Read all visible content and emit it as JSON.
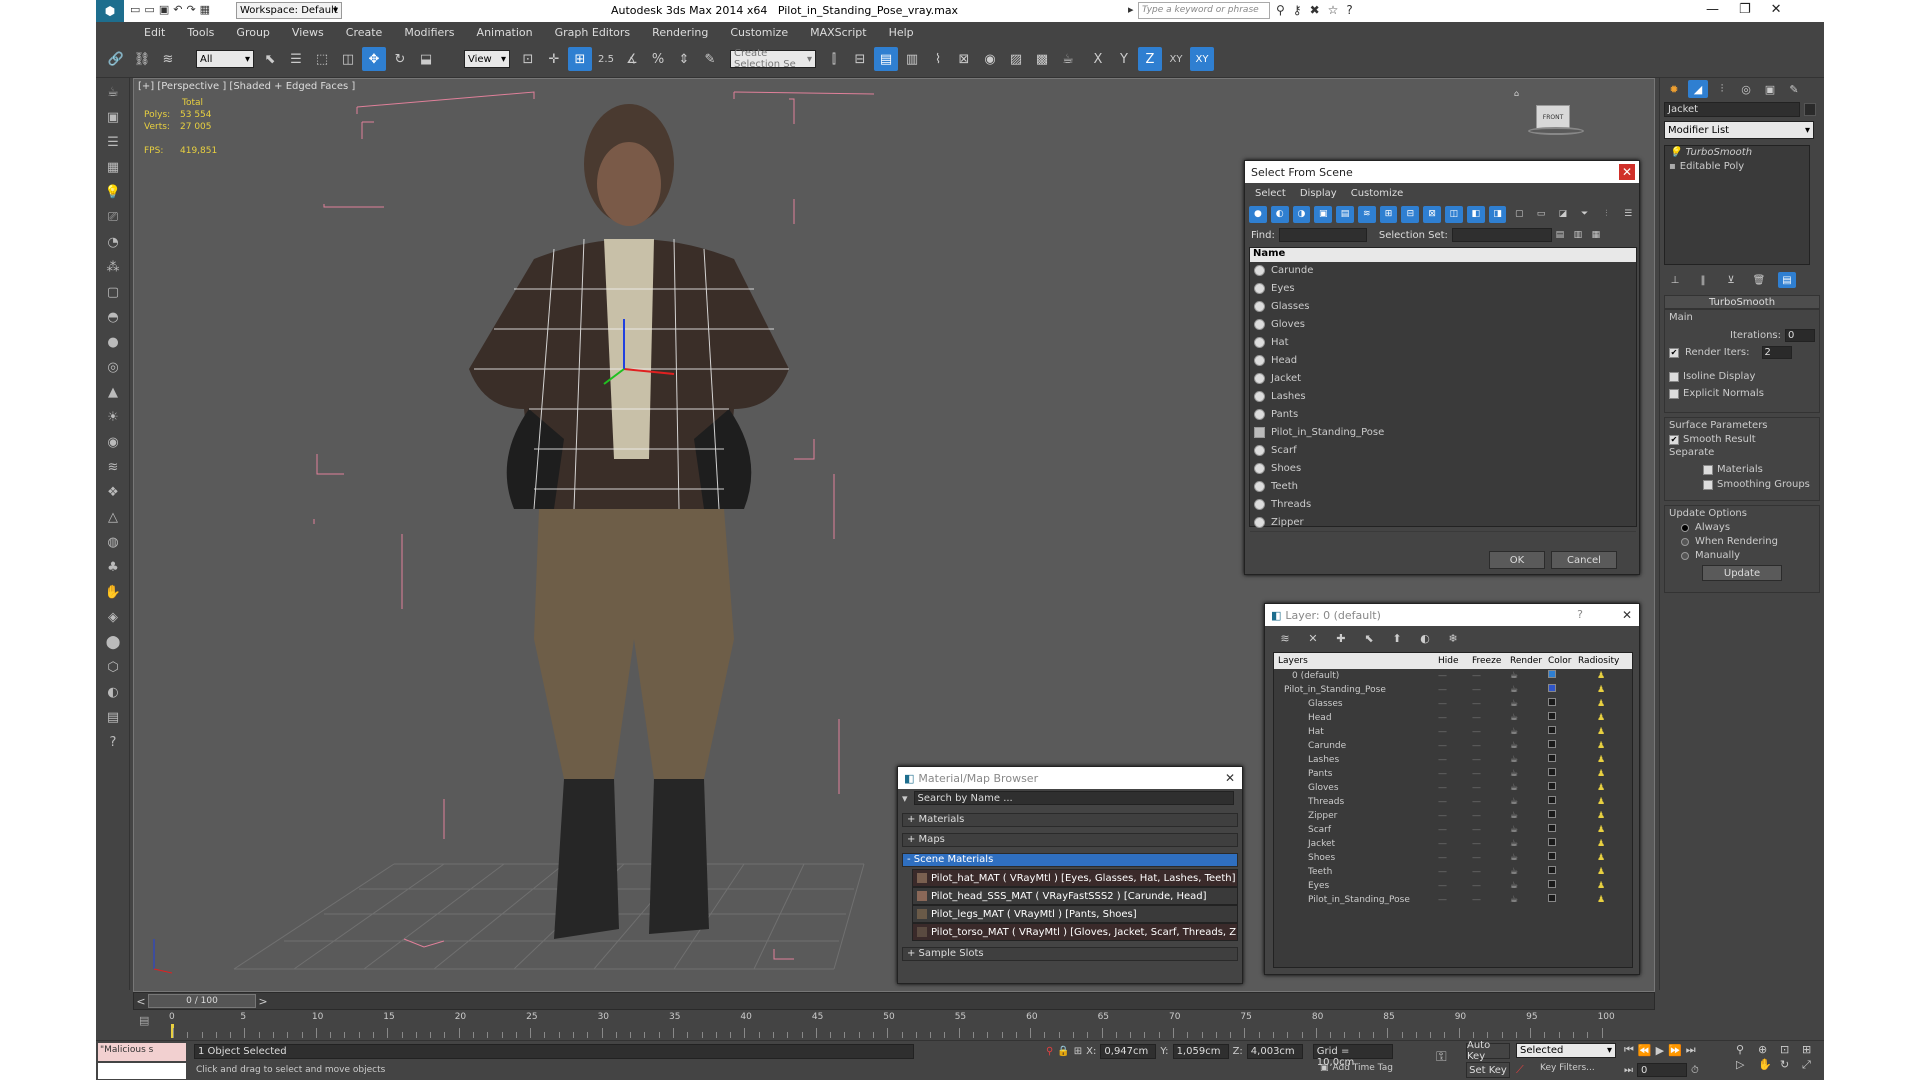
{
  "titlebar": {
    "workspace_label": "Workspace: Default",
    "app_title": "Autodesk 3ds Max  2014 x64",
    "file_name": "Pilot_in_Standing_Pose_vray.max",
    "search_placeholder": "Type a keyword or phrase"
  },
  "menu": [
    "Edit",
    "Tools",
    "Group",
    "Views",
    "Create",
    "Modifiers",
    "Animation",
    "Graph Editors",
    "Rendering",
    "Customize",
    "MAXScript",
    "Help"
  ],
  "toolbar": {
    "filter_value": "All",
    "refcoord_value": "View",
    "snap_label": "2.5",
    "percent_label": "%",
    "named_selection_placeholder": "Create Selection Se",
    "axis_x": "X",
    "axis_y": "Y",
    "axis_z": "Z",
    "axis_xy": "XY",
    "axis_xy2": "XY"
  },
  "viewport": {
    "label": "[+] [Perspective ] [Shaded + Edged Faces ]",
    "stats_total": "Total",
    "polys_label": "Polys:",
    "polys_value": "53 554",
    "verts_label": "Verts:",
    "verts_value": "27 005",
    "fps_label": "FPS:",
    "fps_value": "419,851",
    "viewcube_label": "FRONT"
  },
  "select_from_scene": {
    "title": "Select From Scene",
    "menu": [
      "Select",
      "Display",
      "Customize"
    ],
    "find_label": "Find:",
    "selection_set_label": "Selection Set:",
    "column_name": "Name",
    "items": [
      "Carunde",
      "Eyes",
      "Glasses",
      "Gloves",
      "Hat",
      "Head",
      "Jacket",
      "Lashes",
      "Pants",
      "Pilot_in_Standing_Pose",
      "Scarf",
      "Shoes",
      "Teeth",
      "Threads",
      "Zipper"
    ],
    "ok": "OK",
    "cancel": "Cancel"
  },
  "layer_dialog": {
    "title": "Layer: 0 (default)",
    "help": "?",
    "columns": [
      "Layers",
      "Hide",
      "Freeze",
      "Render",
      "Color",
      "Radiosity"
    ],
    "layers": [
      "0 (default)",
      "Pilot_in_Standing_Pose"
    ],
    "children": [
      "Glasses",
      "Head",
      "Hat",
      "Carunde",
      "Lashes",
      "Pants",
      "Gloves",
      "Threads",
      "Zipper",
      "Scarf",
      "Jacket",
      "Shoes",
      "Teeth",
      "Eyes",
      "Pilot_in_Standing_Pose"
    ],
    "colors": {
      "default_layer": "#2f7fd1",
      "pilot_layer": "#2f55c8",
      "object": "#1a1a1a",
      "radiosity": "#e8d040"
    }
  },
  "material_browser": {
    "title": "Material/Map Browser",
    "search_placeholder": "Search by Name ...",
    "groups": {
      "materials": "+ Materials",
      "maps": "+ Maps",
      "scene": "- Scene Materials",
      "sample": "+ Sample Slots"
    },
    "scene_materials": [
      "Pilot_hat_MAT  ( VRayMtl ) [Eyes, Glasses, Hat, Lashes, Teeth]",
      "Pilot_head_SSS_MAT  ( VRayFastSSS2 ) [Carunde, Head]",
      "Pilot_legs_MAT  ( VRayMtl ) [Pants, Shoes]",
      "Pilot_torso_MAT  ( VRayMtl ) [Gloves, Jacket, Scarf, Threads, Z..."
    ]
  },
  "command_panel": {
    "object_name": "Jacket",
    "modifier_list": "Modifier List",
    "stack": [
      "TurboSmooth",
      "Editable Poly"
    ],
    "rollout_title": "TurboSmooth",
    "main": "Main",
    "iterations_label": "Iterations:",
    "iterations_value": "0",
    "render_iters_label": "Render Iters:",
    "render_iters_value": "2",
    "isoline": "Isoline Display",
    "explicit": "Explicit Normals",
    "surface_params": "Surface Parameters",
    "smooth_result": "Smooth Result",
    "separate": "Separate",
    "materials": "Materials",
    "smoothing_groups": "Smoothing Groups",
    "update_options": "Update Options",
    "always": "Always",
    "when_rendering": "When Rendering",
    "manually": "Manually",
    "update": "Update"
  },
  "timeline": {
    "frame_counter": "0 / 100",
    "ticks": [
      "0",
      "5",
      "10",
      "15",
      "20",
      "25",
      "30",
      "35",
      "40",
      "45",
      "50",
      "55",
      "60",
      "65",
      "70",
      "75",
      "80",
      "85",
      "90",
      "95",
      "100"
    ]
  },
  "status": {
    "script_text": "\"Malicious s",
    "selection": "1 Object Selected",
    "prompt": "Click and drag to select and move objects",
    "x_label": "X:",
    "x_value": "0,947cm",
    "y_label": "Y:",
    "y_value": "1,059cm",
    "z_label": "Z:",
    "z_value": "4,003cm",
    "grid": "Grid = 10,0cm",
    "add_time_tag": "Add Time Tag",
    "auto_key": "Auto Key",
    "set_key": "Set Key",
    "selected_value": "Selected",
    "key_filters": "Key Filters...",
    "current_frame": "0"
  }
}
